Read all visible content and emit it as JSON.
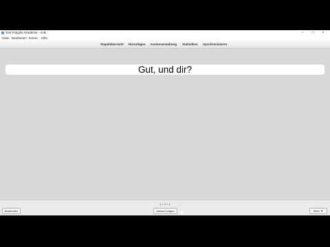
{
  "window": {
    "title": "Test Polyglot Akademie - Anki",
    "controls": {
      "minimize": "–",
      "maximize": "□",
      "close": "×"
    }
  },
  "menu": [
    "Datei",
    "Bearbeiten",
    "Extras",
    "Hilfe"
  ],
  "toolbar": [
    "Stapelübersicht",
    "Hinzufügen",
    "Kartenverwaltung",
    "Statistiken",
    "Synchronisieren"
  ],
  "card": {
    "text": "Gut, und dir?"
  },
  "bottombar": {
    "edit_label": "Bearbeiten",
    "counts": "1 + 2 + 1",
    "show_answer_label": "Antwort zeigen",
    "more_label": "Mehr ▼"
  },
  "colors": {
    "background": "#d8d8d8",
    "card": "#ffffff",
    "bottombar": "#ebebeb"
  }
}
